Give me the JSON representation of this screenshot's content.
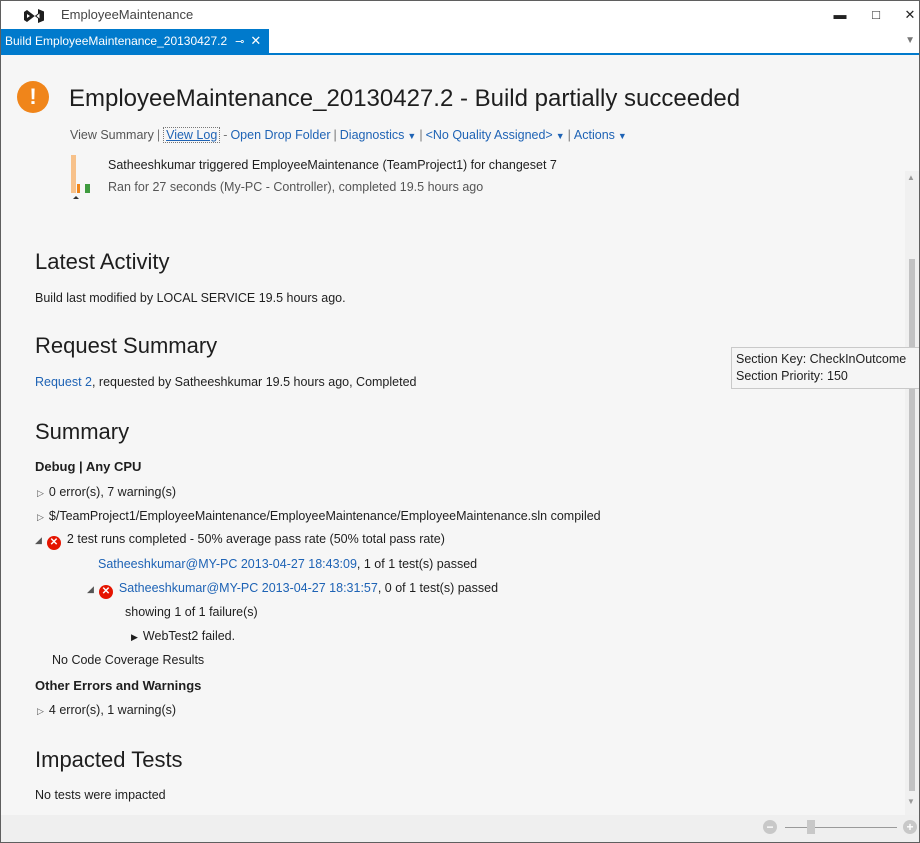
{
  "app": {
    "title": "EmployeeMaintenance",
    "logo_icon": "visual-studio-logo-icon"
  },
  "window_controls": {
    "minimize": "▬",
    "maximize": "□",
    "close": "✕"
  },
  "tab": {
    "label": "Build EmployeeMaintenance_20130427.2",
    "pin_icon": "⊸",
    "close_icon": "✕"
  },
  "header": {
    "status_icon": "!",
    "title": "EmployeeMaintenance_20130427.2 - Build partially succeeded",
    "links": {
      "view_summary": "View Summary",
      "view_log": "View Log",
      "open_drop_folder": "Open Drop Folder",
      "diagnostics": "Diagnostics",
      "quality": "<No Quality Assigned>",
      "actions": "Actions"
    },
    "trigger_line": "Satheeshkumar triggered EmployeeMaintenance (TeamProject1) for changeset 7",
    "ran_line": "Ran for 27 seconds (My-PC - Controller), completed 19.5 hours ago"
  },
  "latest_activity": {
    "heading": "Latest Activity",
    "text": "Build last modified by LOCAL SERVICE 19.5 hours ago."
  },
  "request_summary": {
    "heading": "Request Summary",
    "link": "Request 2",
    "text": ", requested by Satheeshkumar 19.5 hours ago, Completed"
  },
  "summary": {
    "heading": "Summary",
    "config": "Debug | Any CPU",
    "errors_line": "0 error(s), 7 warning(s)",
    "compiled_line": "$/TeamProject1/EmployeeMaintenance/EmployeeMaintenance/EmployeeMaintenance.sln compiled",
    "test_runs_line": "2 test runs completed - 50% average pass rate (50% total pass rate)",
    "run1_link": "Satheeshkumar@MY-PC 2013-04-27 18:43:09",
    "run1_text": ", 1 of 1 test(s) passed",
    "run2_link": "Satheeshkumar@MY-PC 2013-04-27 18:31:57",
    "run2_text": ", 0 of 1 test(s) passed",
    "showing_failures": "showing 1 of 1 failure(s)",
    "failed_test": "WebTest2 failed.",
    "coverage": "No Code Coverage Results",
    "other_heading": "Other Errors and Warnings",
    "other_line": "4 error(s), 1 warning(s)"
  },
  "impacted_tests": {
    "heading": "Impacted Tests",
    "text": "No tests were impacted"
  },
  "tooltip": {
    "line1": "Section Key: CheckInOutcome",
    "line2": "Section Priority: 150"
  },
  "zoom": {
    "minus": "−",
    "plus": "+"
  },
  "colors": {
    "accent": "#007acc",
    "warning": "#f0851a",
    "error": "#e51400",
    "link": "#1e63b5"
  }
}
